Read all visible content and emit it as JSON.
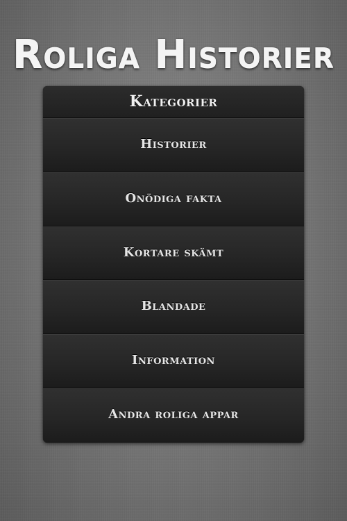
{
  "app": {
    "title": "Roliga Historier"
  },
  "menu": {
    "header": "Kategorier",
    "items": [
      {
        "label": "Historier"
      },
      {
        "label": "Onödiga fakta"
      },
      {
        "label": "Kortare skämt"
      },
      {
        "label": "Blandade"
      },
      {
        "label": "Information"
      },
      {
        "label": "Andra roliga appar"
      }
    ]
  },
  "colors": {
    "background": "#7a7a7a",
    "panel": "#232323",
    "text": "#f0f0f0"
  }
}
